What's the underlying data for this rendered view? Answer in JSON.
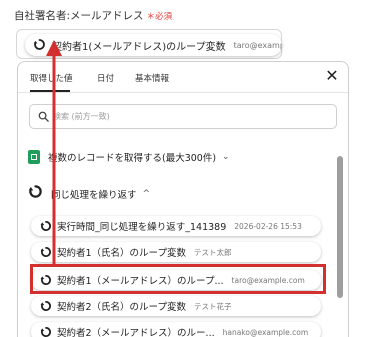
{
  "field": {
    "label": "自社署名者:メールアドレス",
    "required": "必須",
    "required_mark": "＊"
  },
  "top_value": {
    "name": "契約者1(メールアドレス)のループ変数",
    "value": "taro@example"
  },
  "tabs": [
    "取得した値",
    "日付",
    "基本情報"
  ],
  "close_label": "✕",
  "search": {
    "placeholder": "検索 (前方一致)"
  },
  "sections": {
    "sheets": "複数のレコードを取得する(最大300件)",
    "loop": "同じ処理を繰り返す",
    "chevron_down": "⌄",
    "chevron_up": "^"
  },
  "items": [
    {
      "name": "実行時間_同じ処理を繰り返す_141389",
      "value": "2026-02-26 15:53"
    },
    {
      "name": "契約者1（氏名）のループ変数",
      "value": "テスト太郎"
    },
    {
      "name": "契約者1（メールアドレス）のループ...",
      "value": "taro@example.com"
    },
    {
      "name": "契約者2（氏名）のループ変数",
      "value": "テスト花子"
    },
    {
      "name": "契約者2（メールアドレス）のルー...",
      "value": "hanako@example.com"
    }
  ],
  "colors": {
    "highlight": "#d32f2f",
    "sheets_green": "#1e9e5a",
    "required_red": "#e53935"
  },
  "icons": {
    "loop": "loop-icon",
    "search": "search-icon",
    "close": "close-icon",
    "sheets": "sheets-icon"
  }
}
